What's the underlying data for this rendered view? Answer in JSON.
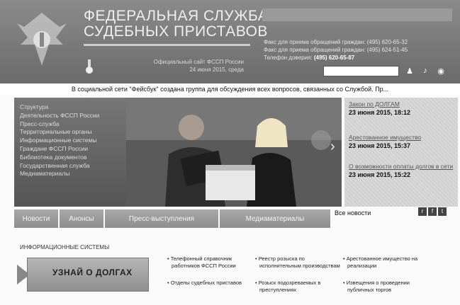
{
  "header": {
    "title_line1": "ФЕДЕРАЛЬНАЯ СЛУЖБА",
    "title_line2": "СУДЕБНЫХ ПРИСТАВОВ",
    "subtitle": "Официальный сайт ФССП России",
    "date": "24 июня 2015, среда",
    "contacts": {
      "line1": "Факс для приема обращений граждан: (495) 620-65-32",
      "line2": "Факс для приема обращений граждан: (495) 624-51-45",
      "line3_label": "Телефон доверия:",
      "line3_value": "(495) 620-65-87"
    },
    "search_placeholder": "",
    "icons": [
      "user-icon",
      "sound-icon",
      "eye-icon"
    ]
  },
  "announcement": "В социальной сети \"Фейсбук\" создана группа для обсуждения всех вопросов, связанных со Службой. Пр...",
  "left_menu": [
    "Структура",
    "Деятельность ФССП России",
    "Пресс-служба",
    "Территориальные органы",
    "Информационные системы",
    "Граждане ФССП России",
    "Библиотека документов",
    "Государственная служба",
    "Медиаматериалы"
  ],
  "news": [
    {
      "title": "Закон по ДОЛГАМ",
      "date": "23 июня 2015, 18:12"
    },
    {
      "title": "Арестованное имущество",
      "date": "23 июня 2015, 15:37"
    },
    {
      "title": "О возможности оплаты долгов в сети",
      "date": "23 июня 2015, 15:22"
    }
  ],
  "tabs": [
    "Новости",
    "Анонсы",
    "Пресс-выступления",
    "Медиаматериалы"
  ],
  "all_news": "Все новости",
  "rss_icons": [
    "rss-icon",
    "social-icon",
    "feed-icon"
  ],
  "info_section_title": "ИНФОРМАЦИОННЫЕ СИСТЕМЫ",
  "promo_label": "УЗНАЙ О ДОЛГАХ",
  "links": {
    "col1": [
      "• Телефонный справочник работников ФССП России",
      "• Отделы судебных приставов"
    ],
    "col2": [
      "• Реестр розыска по исполнительным производствам",
      "• Розыск подозреваемых в преступлениях"
    ],
    "col3": [
      "• Арестованное имущество на реализации",
      "• Извещения о проведении публичных торгов"
    ]
  }
}
